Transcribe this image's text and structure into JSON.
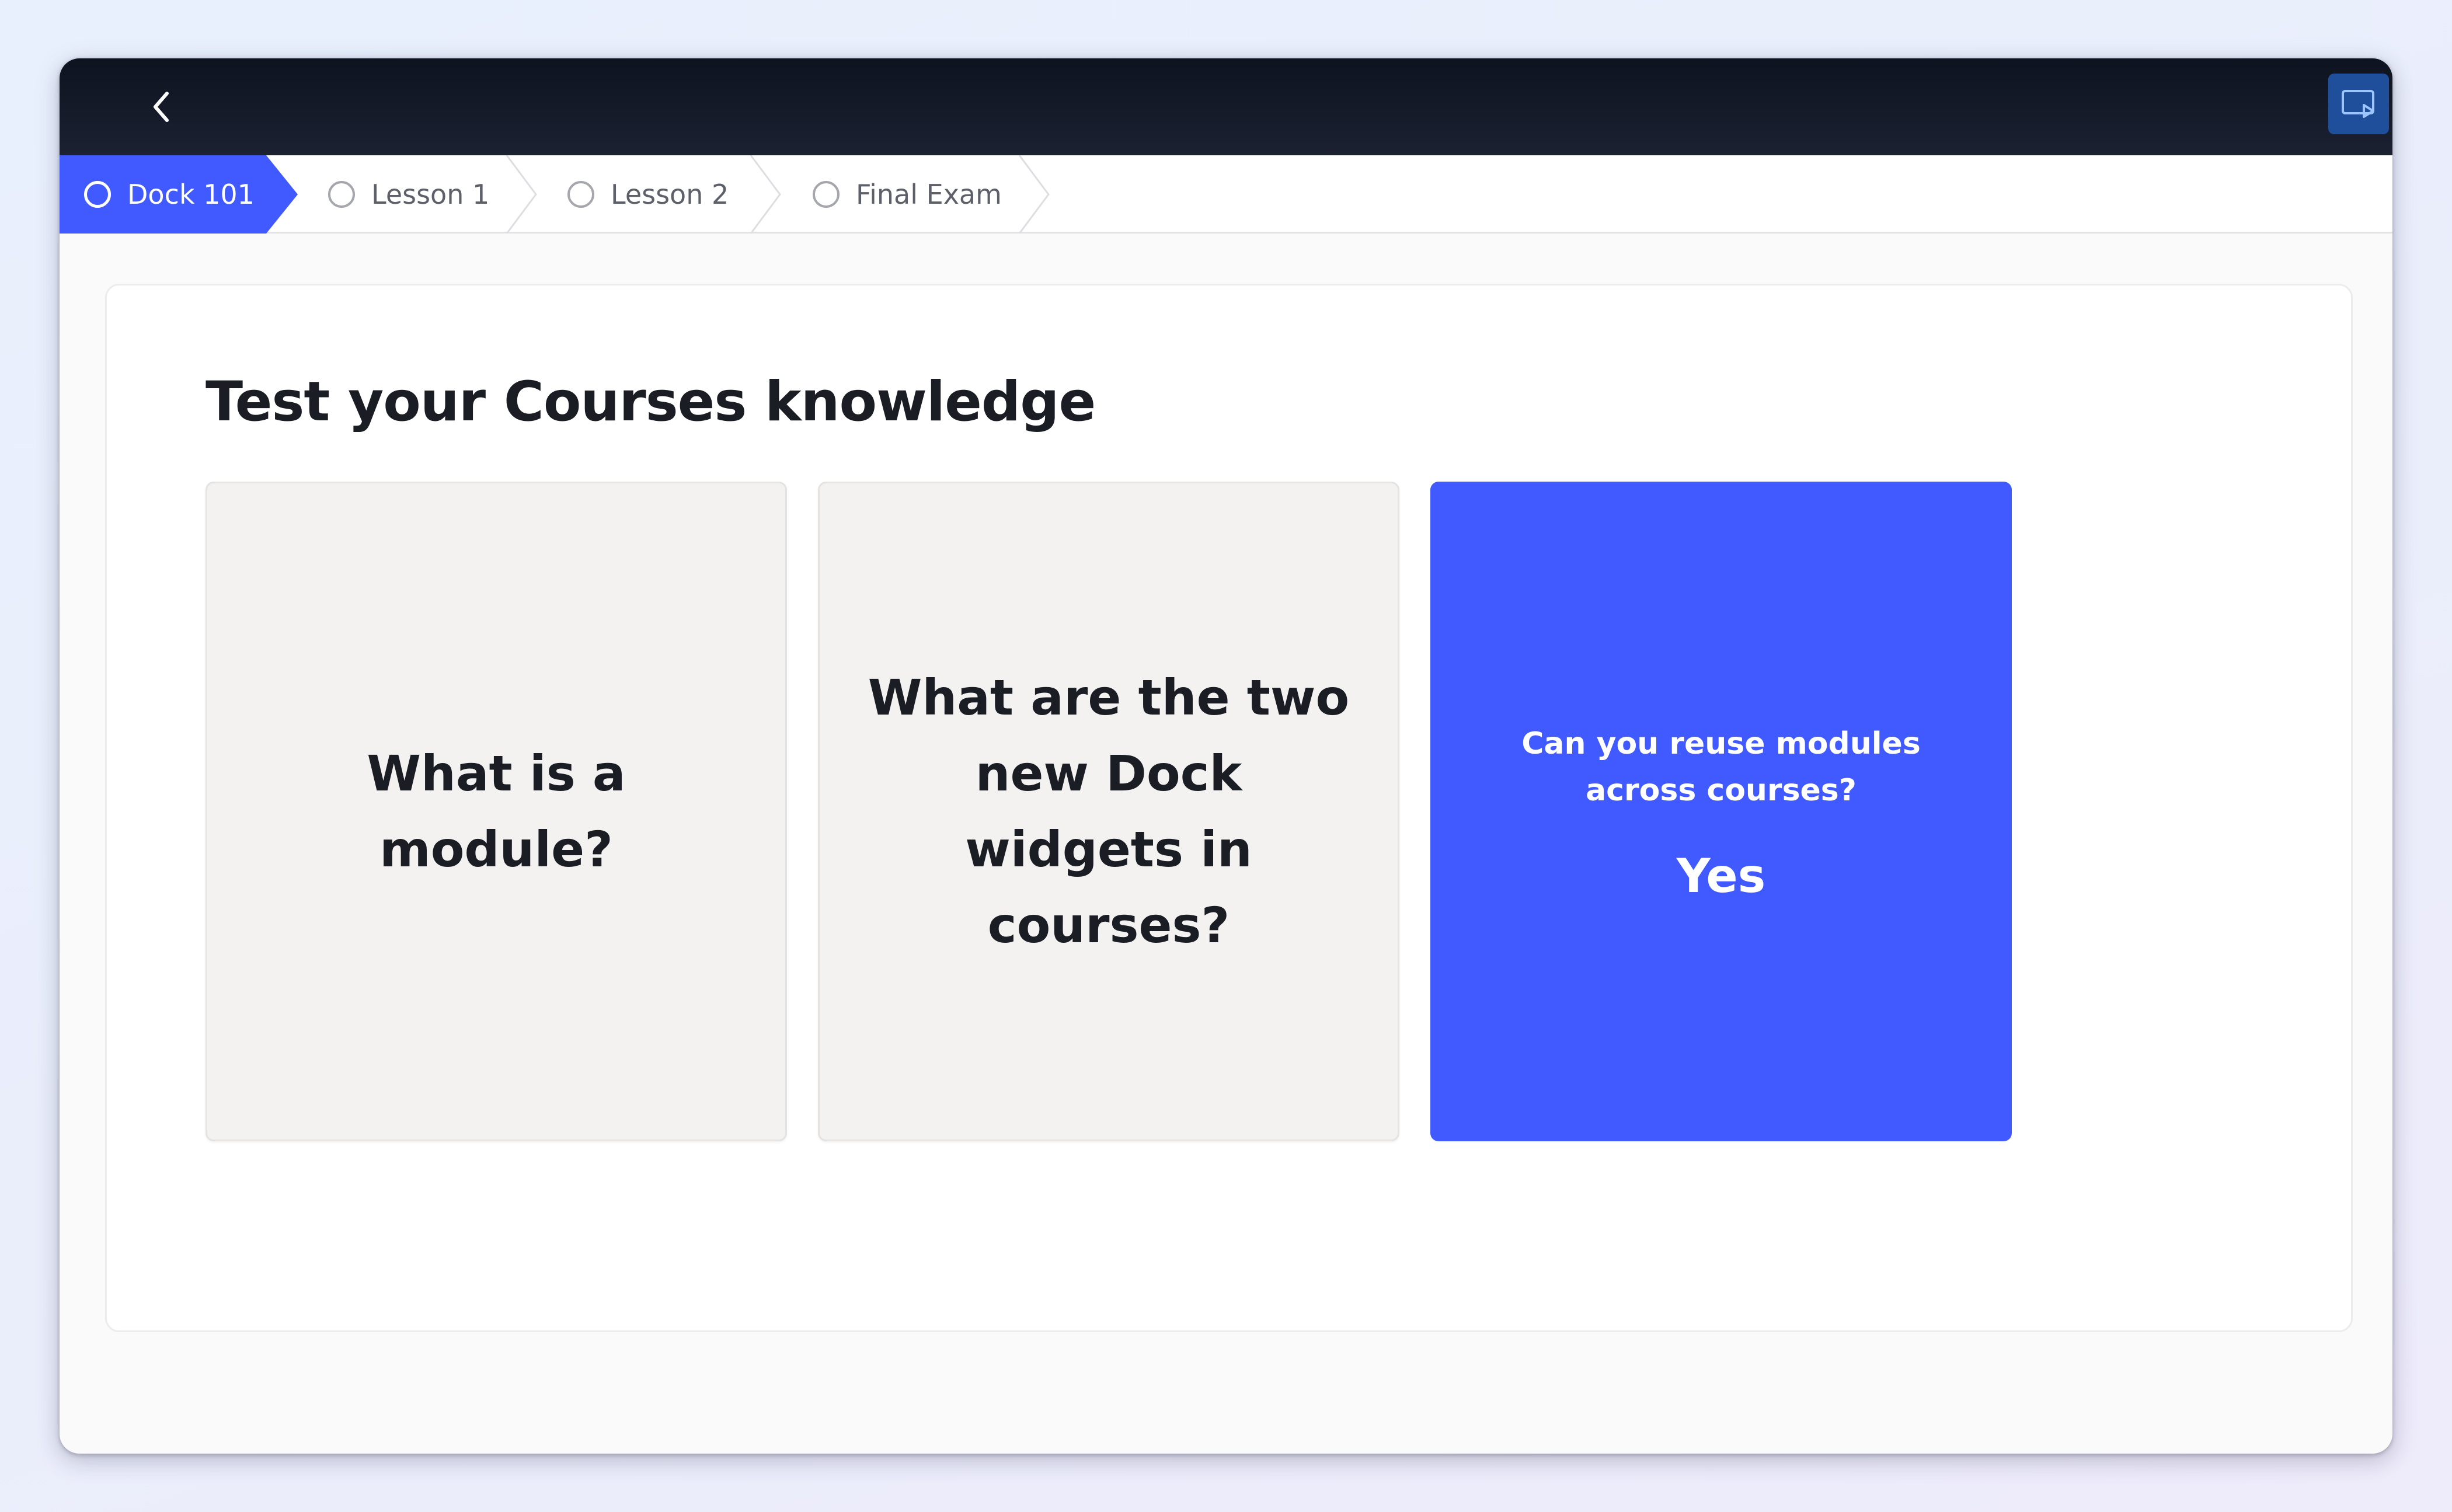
{
  "steps": [
    {
      "label": "Dock 101",
      "active": true
    },
    {
      "label": "Lesson 1",
      "active": false
    },
    {
      "label": "Lesson 2",
      "active": false
    },
    {
      "label": "Final Exam",
      "active": false
    }
  ],
  "main": {
    "title": "Test your Courses knowledge",
    "cards": [
      {
        "question": "What is a module?"
      },
      {
        "question": "What are the two new Dock widgets in courses?"
      },
      {
        "question": "Can you reuse modules across courses?",
        "answer": "Yes"
      }
    ]
  },
  "colors": {
    "accent": "#405aff",
    "topbar": "#141927",
    "card_grey": "#f3f2f1"
  },
  "icons": {
    "back": "chevron-left-icon",
    "present": "present-screen-icon",
    "step": "circle-outline-icon"
  }
}
